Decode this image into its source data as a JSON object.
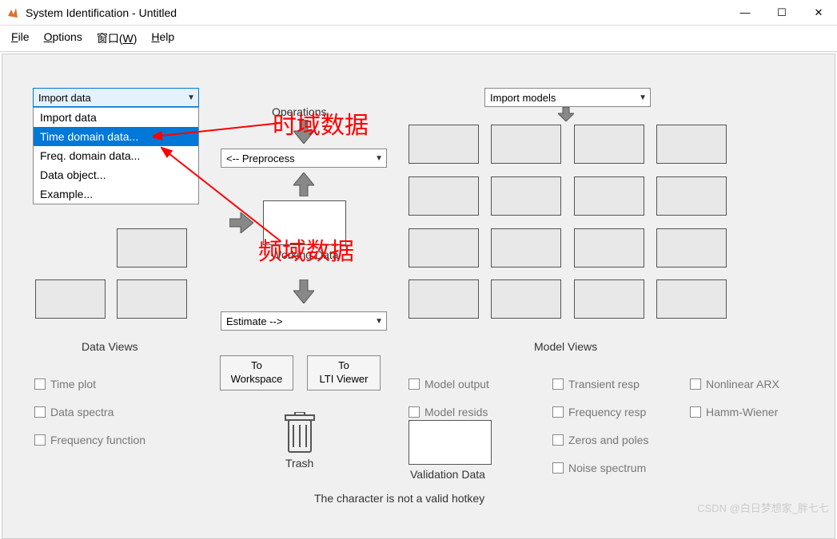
{
  "window": {
    "title": "System Identification - Untitled",
    "min": "—",
    "max": "☐",
    "close": "✕"
  },
  "menu": {
    "file": "File",
    "options": "Options",
    "window": "窗口(W)",
    "help": "Help"
  },
  "import_data": {
    "label": "Import data",
    "options": [
      "Import data",
      "Time domain data...",
      "Freq. domain data...",
      "Data object...",
      "Example..."
    ]
  },
  "import_models": {
    "label": "Import models"
  },
  "operations": {
    "label": "Operations",
    "preprocess": "<-- Preprocess",
    "working": "Working Data",
    "estimate": "Estimate -->"
  },
  "data_views": {
    "heading": "Data Views",
    "time_plot": "Time plot",
    "data_spectra": "Data spectra",
    "freq_func": "Frequency function"
  },
  "model_views": {
    "heading": "Model Views",
    "output": "Model output",
    "resids": "Model resids",
    "transient": "Transient resp",
    "freq": "Frequency resp",
    "zeros": "Zeros and poles",
    "noise": "Noise spectrum",
    "nlarx": "Nonlinear ARX",
    "hw": "Hamm-Wiener"
  },
  "buttons": {
    "to_ws": "To\nWorkspace",
    "to_lti": "To\nLTI Viewer"
  },
  "labels": {
    "trash": "Trash",
    "validation": "Validation Data"
  },
  "status": "The character   is not a valid hotkey",
  "annotations": {
    "time": "时域数据",
    "freq": "频域数据"
  },
  "watermark": "CSDN @白日梦想家_胖七七"
}
